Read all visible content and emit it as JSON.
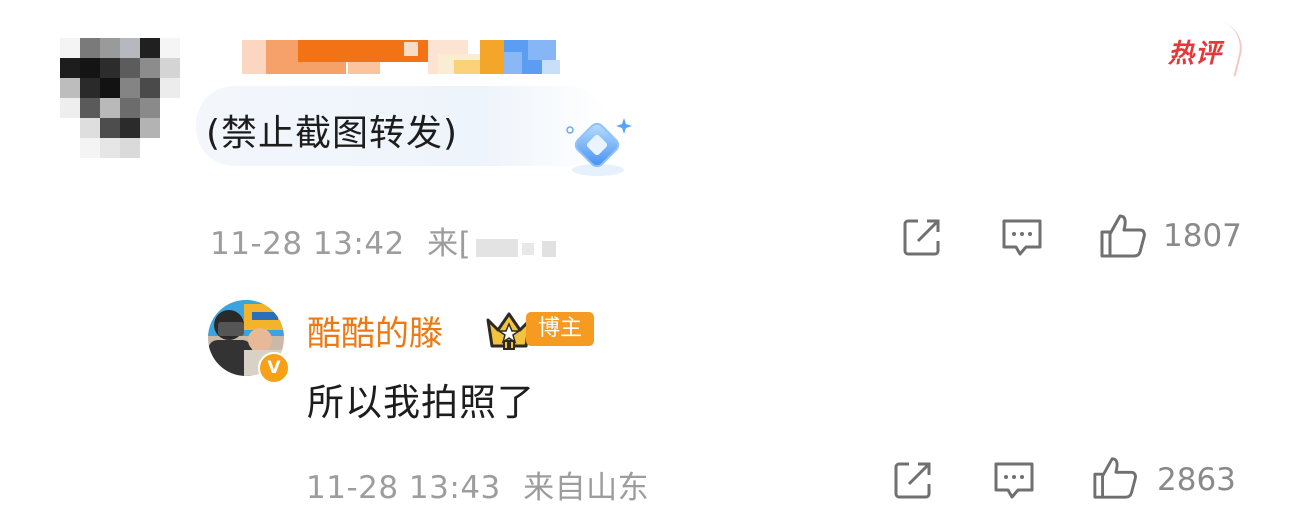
{
  "top_comment": {
    "badge": "热评",
    "text": "(禁止截图转发)",
    "time": "11-28 13:42",
    "location_prefix": "来[",
    "icons": [
      "share-icon",
      "comment-icon",
      "like-icon"
    ],
    "likes": "1807"
  },
  "reply": {
    "author": "酷酷的滕",
    "author_tag": "博主",
    "verified_mark": "V",
    "text": "所以我拍照了",
    "time": "11-28 13:43",
    "location": "来自山东",
    "icons": [
      "share-icon",
      "comment-icon",
      "like-icon"
    ],
    "likes": "2863"
  },
  "colors": {
    "name_orange": "#ec7a14",
    "badge_red": "#e8373a",
    "tag_orange": "#f59b21",
    "meta_gray": "#9d9d9d",
    "text_dark": "#1d1d1d"
  }
}
